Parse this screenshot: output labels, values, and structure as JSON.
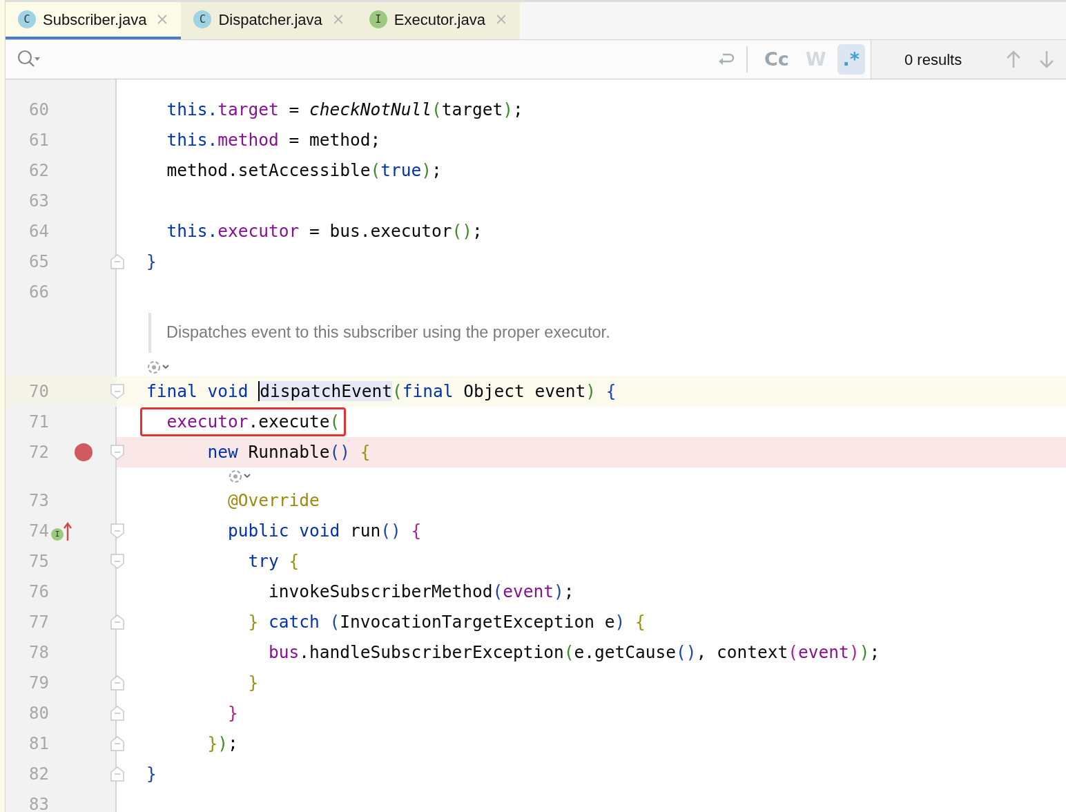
{
  "tabs": [
    {
      "label": "Subscriber.java",
      "icon_letter": "C",
      "color": "#9fd3e3",
      "selected": true
    },
    {
      "label": "Dispatcher.java",
      "icon_letter": "C",
      "color": "#9fd3e3",
      "selected": false
    },
    {
      "label": "Executor.java",
      "icon_letter": "I",
      "color": "#9cc97e",
      "selected": false
    }
  ],
  "search_bar": {
    "toggles": [
      {
        "label": "Cc",
        "on": false,
        "disabled": false
      },
      {
        "label": "W",
        "on": false,
        "disabled": true
      },
      {
        "label": ".*",
        "on": true,
        "disabled": false
      }
    ],
    "results": "0 results"
  },
  "lines": [
    {
      "kind": "code",
      "number": "60",
      "tokens": [
        {
          "text": "  this.",
          "kind": "keyword"
        },
        {
          "text": "target",
          "kind": "field"
        },
        {
          "text": " = "
        },
        {
          "text": "checkNotNull",
          "kind": "static"
        },
        {
          "text": "(",
          "kind": "paren-green"
        },
        {
          "text": "target"
        },
        {
          "text": ")",
          "kind": "paren-green"
        },
        {
          "text": ";"
        }
      ]
    },
    {
      "kind": "code",
      "number": "61",
      "tokens": [
        {
          "text": "  this.",
          "kind": "keyword"
        },
        {
          "text": "method",
          "kind": "field"
        },
        {
          "text": " = method;"
        }
      ]
    },
    {
      "kind": "code",
      "number": "62",
      "tokens": [
        {
          "text": "  method.setAccessible"
        },
        {
          "text": "(",
          "kind": "paren-green"
        },
        {
          "text": "true",
          "kind": "keyword"
        },
        {
          "text": ")",
          "kind": "paren-green"
        },
        {
          "text": ";"
        }
      ]
    },
    {
      "kind": "code",
      "number": "63"
    },
    {
      "kind": "code",
      "number": "64",
      "tokens": [
        {
          "text": "  this.",
          "kind": "keyword"
        },
        {
          "text": "executor",
          "kind": "field"
        },
        {
          "text": " = bus.executor"
        },
        {
          "text": "()",
          "kind": "paren-green"
        },
        {
          "text": ";"
        }
      ]
    },
    {
      "kind": "code",
      "number": "65",
      "fold": {
        "kind": "end"
      },
      "tokens": [
        {
          "text": "}",
          "kind": "paren-blue"
        }
      ]
    },
    {
      "kind": "code",
      "number": "66"
    },
    {
      "kind": "doc",
      "text": "Dispatches event to this subscriber using the proper executor."
    },
    {
      "kind": "inlay"
    },
    {
      "kind": "code",
      "number": "70",
      "fold": {
        "kind": "start"
      },
      "current": true,
      "tokens": [
        {
          "text": "final void ",
          "kind": "keyword"
        },
        {
          "text": "dispatchEvent",
          "highlight": true,
          "caret": true
        },
        {
          "text": "(",
          "kind": "paren-green"
        },
        {
          "text": "final",
          "kind": "keyword"
        },
        {
          "text": " Object event"
        },
        {
          "text": ")",
          "kind": "paren-green"
        },
        {
          "text": " {",
          "kind": "paren-blue"
        }
      ]
    },
    {
      "kind": "code",
      "number": "71",
      "framed": true,
      "tokens": [
        {
          "text": "  executor",
          "kind": "field"
        },
        {
          "text": ".execute"
        },
        {
          "text": "(",
          "kind": "paren-green"
        }
      ]
    },
    {
      "kind": "code",
      "number": "72",
      "fold": {
        "kind": "start"
      },
      "breakpoint": true,
      "tokens": [
        {
          "text": "      new",
          "kind": "keyword"
        },
        {
          "text": " Runnable"
        },
        {
          "text": "()",
          "kind": "paren-blue"
        },
        {
          "text": " {",
          "kind": "paren-olive"
        }
      ]
    },
    {
      "kind": "inlay"
    },
    {
      "kind": "code",
      "number": "73",
      "tokens": [
        {
          "text": "        @Override",
          "kind": "annotation"
        }
      ]
    },
    {
      "kind": "code",
      "number": "74",
      "fold": {
        "kind": "start"
      },
      "marker": {
        "kind": "implements",
        "letter": "I"
      },
      "tokens": [
        {
          "text": "        public void",
          "kind": "keyword"
        },
        {
          "text": " run"
        },
        {
          "text": "()",
          "kind": "paren-blue"
        },
        {
          "text": " {",
          "kind": "paren-purple"
        }
      ]
    },
    {
      "kind": "code",
      "number": "75",
      "fold": {
        "kind": "start"
      },
      "tokens": [
        {
          "text": "          try",
          "kind": "keyword"
        },
        {
          "text": " {",
          "kind": "paren-olive"
        }
      ]
    },
    {
      "kind": "code",
      "number": "76",
      "tokens": [
        {
          "text": "            invokeSubscriberMethod"
        },
        {
          "text": "(",
          "kind": "paren-blue"
        },
        {
          "text": "event",
          "kind": "field"
        },
        {
          "text": ")",
          "kind": "paren-blue"
        },
        {
          "text": ";"
        }
      ]
    },
    {
      "kind": "code",
      "number": "77",
      "fold": {
        "kind": "end"
      },
      "tokens": [
        {
          "text": "          }",
          "kind": "paren-olive"
        },
        {
          "text": " catch",
          "kind": "keyword"
        },
        {
          "text": " (",
          "kind": "paren-blue"
        },
        {
          "text": "InvocationTargetException e"
        },
        {
          "text": ")",
          "kind": "paren-blue"
        },
        {
          "text": " {",
          "kind": "paren-olive"
        }
      ]
    },
    {
      "kind": "code",
      "number": "78",
      "tokens": [
        {
          "text": "            bus",
          "kind": "field"
        },
        {
          "text": ".handleSubscriberException"
        },
        {
          "text": "(",
          "kind": "paren-green"
        },
        {
          "text": "e.getCause"
        },
        {
          "text": "()",
          "kind": "paren-blue"
        },
        {
          "text": ", context"
        },
        {
          "text": "(",
          "kind": "paren-purple"
        },
        {
          "text": "event",
          "kind": "field"
        },
        {
          "text": ")",
          "kind": "paren-purple"
        },
        {
          "text": ")",
          "kind": "paren-green"
        },
        {
          "text": ";"
        }
      ]
    },
    {
      "kind": "code",
      "number": "79",
      "fold": {
        "kind": "end"
      },
      "tokens": [
        {
          "text": "          }",
          "kind": "paren-olive"
        }
      ]
    },
    {
      "kind": "code",
      "number": "80",
      "fold": {
        "kind": "end"
      },
      "tokens": [
        {
          "text": "        }",
          "kind": "paren-purple"
        }
      ]
    },
    {
      "kind": "code",
      "number": "81",
      "fold": {
        "kind": "end"
      },
      "tokens": [
        {
          "text": "      }",
          "kind": "paren-olive"
        },
        {
          "text": ")",
          "kind": "paren-green"
        },
        {
          "text": ";"
        }
      ]
    },
    {
      "kind": "code",
      "number": "82",
      "fold": {
        "kind": "end"
      },
      "tokens": [
        {
          "text": "}",
          "kind": "paren-blue"
        }
      ]
    },
    {
      "kind": "code",
      "number": "83"
    }
  ]
}
